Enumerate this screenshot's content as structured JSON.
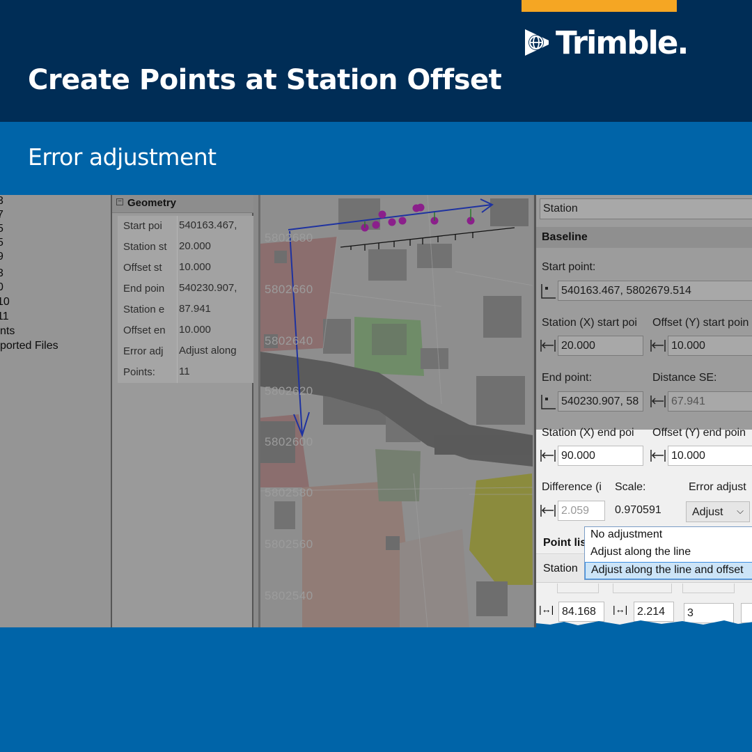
{
  "header": {
    "logo_text": "Trimble.",
    "title": "Create Points at Station Offset",
    "subtitle": "Error adjustment",
    "accent_color": "#f5a623",
    "header_color": "#002d56",
    "band_color": "#0064a8"
  },
  "tree": {
    "items": [
      "3",
      "7",
      "5",
      "5",
      "9",
      "3",
      "0",
      "10",
      "11",
      "nts",
      "ported Files"
    ]
  },
  "properties": {
    "section": "Geometry",
    "rows": [
      {
        "name": "Start poi",
        "value": "540163.467,"
      },
      {
        "name": "Station st",
        "value": "20.000"
      },
      {
        "name": "Offset st",
        "value": "10.000"
      },
      {
        "name": "End poin",
        "value": "540230.907,"
      },
      {
        "name": "Station e",
        "value": "87.941"
      },
      {
        "name": "Offset en",
        "value": "10.000"
      },
      {
        "name": "Error adj",
        "value": "Adjust along"
      },
      {
        "name": "Points:",
        "value": "11"
      }
    ]
  },
  "map": {
    "coords": [
      "5802680",
      "5802660",
      "5802640",
      "5802620",
      "5802600",
      "5802580",
      "5802560",
      "5802540"
    ]
  },
  "dialog": {
    "method_value": "Station",
    "baseline_section": "Baseline",
    "start_point_label": "Start point:",
    "start_point_value": "540163.467, 5802679.514",
    "station_start_label": "Station (X) start poi",
    "offset_start_label": "Offset (Y) start poin",
    "station_start_value": "20.000",
    "offset_start_value": "10.000",
    "end_point_label": "End point:",
    "distance_label": "Distance SE:",
    "end_point_value": "540230.907, 58",
    "distance_value": "67.941",
    "station_end_label": "Station (X) end poi",
    "offset_end_label": "Offset (Y) end poin",
    "station_end_value": "90.000",
    "offset_end_value": "10.000",
    "difference_label": "Difference (i",
    "scale_label": "Scale:",
    "error_label": "Error adjust",
    "difference_value": "2.059",
    "scale_value": "0.970591",
    "error_value": "Adjust",
    "point_list_label": "Point lis",
    "station_col": "Station",
    "error_options": [
      "No adjustment",
      "Adjust along the line",
      "Adjust along the line and offset"
    ],
    "selected_option_index": 2,
    "row_station": "84.168",
    "row_offset": "2.214",
    "row_third": "3"
  }
}
